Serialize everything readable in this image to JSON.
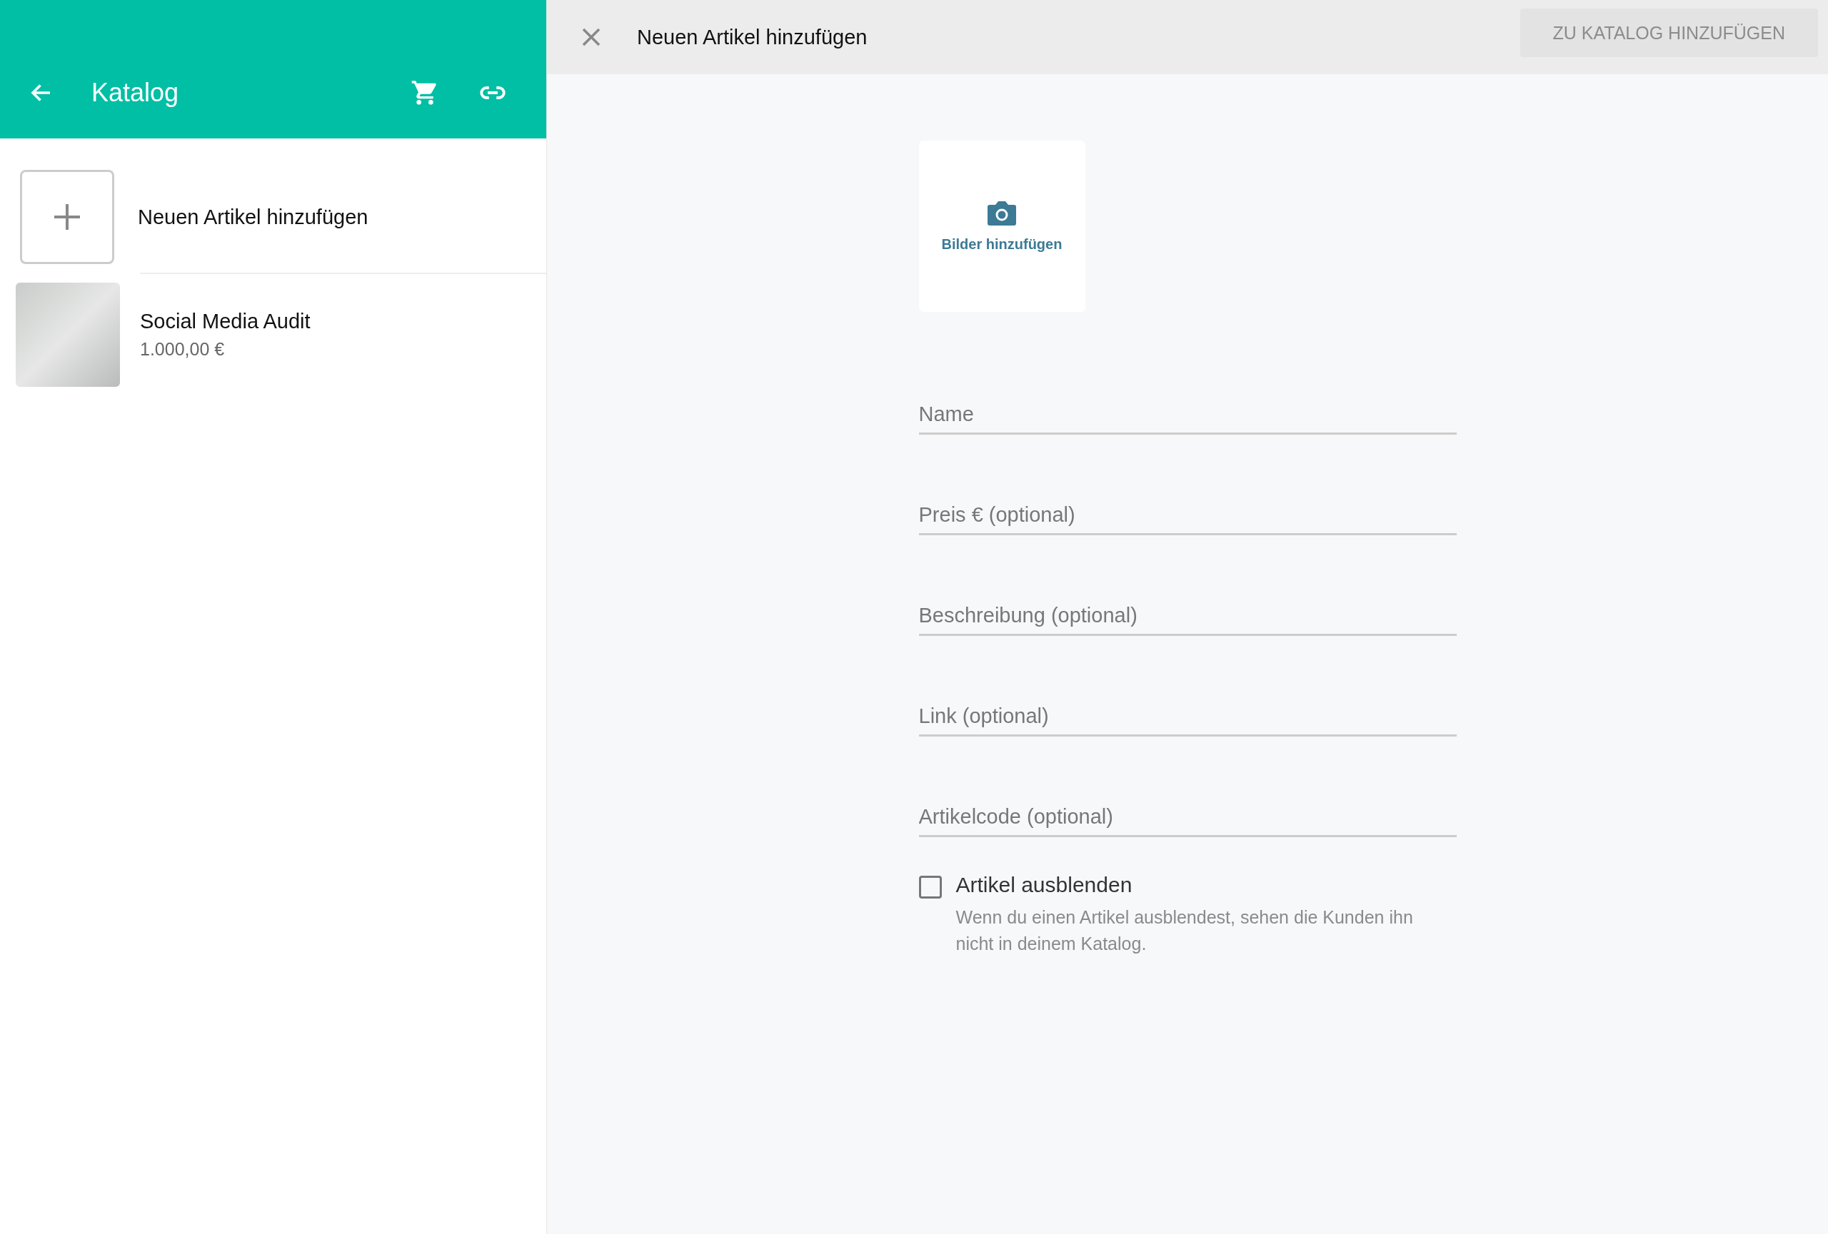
{
  "sidebar": {
    "title": "Katalog",
    "add_item": {
      "label": "Neuen Artikel hinzufügen"
    },
    "products": [
      {
        "name": "Social Media Audit",
        "price": "1.000,00 €"
      }
    ]
  },
  "panel": {
    "title": "Neuen Artikel hinzufügen",
    "submit_button": {
      "label": "ZU KATALOG HINZUFÜGEN",
      "disabled": true
    },
    "image_upload": {
      "label": "Bilder hinzufügen"
    },
    "fields": [
      {
        "placeholder": "Name"
      },
      {
        "placeholder": "Preis € (optional)"
      },
      {
        "placeholder": "Beschreibung (optional)"
      },
      {
        "placeholder": "Link (optional)"
      },
      {
        "placeholder": "Artikelcode (optional)"
      }
    ],
    "hide_option": {
      "label": "Artikel ausblenden",
      "checked": false,
      "help": "Wenn du einen Artikel ausblendest, sehen die Kunden ihn nicht in deinem Katalog."
    }
  }
}
